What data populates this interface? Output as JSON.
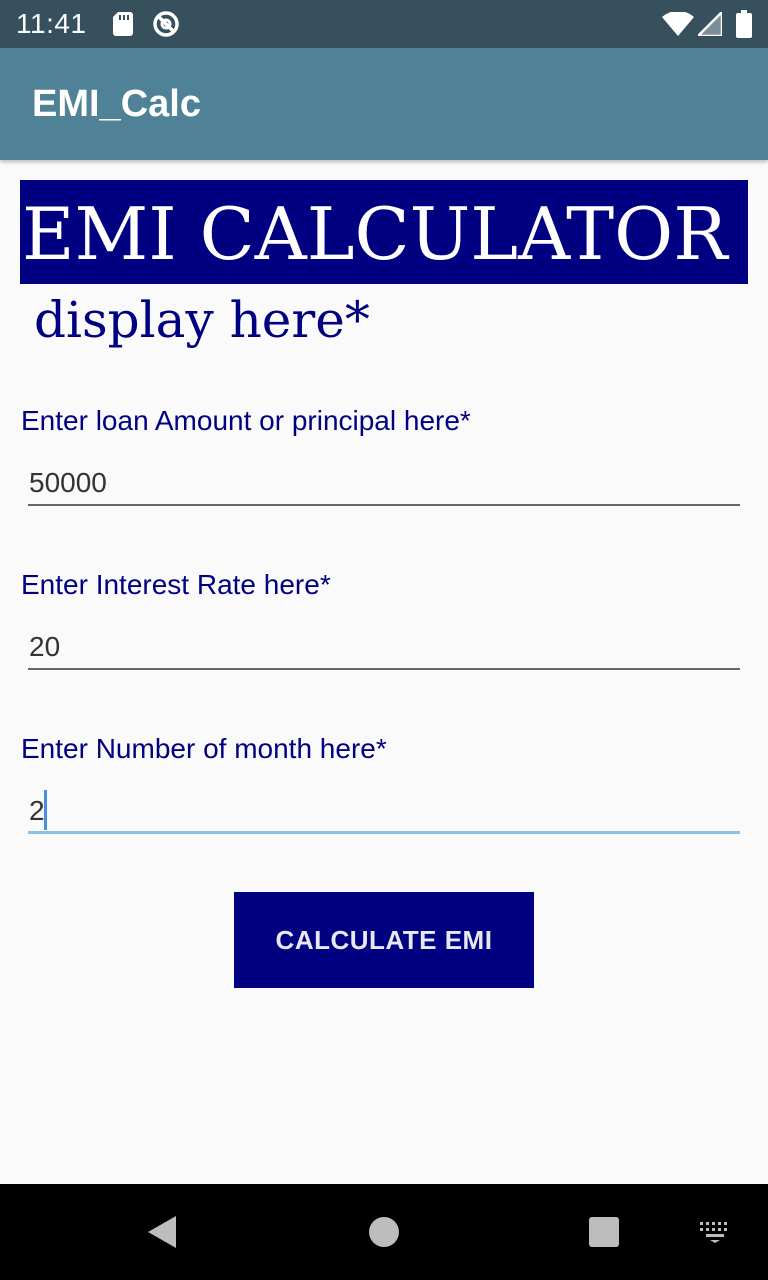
{
  "status_bar": {
    "time": "11:41",
    "icons": [
      "sd-card-icon",
      "sync-disabled-icon",
      "wifi-icon",
      "signal-icon",
      "battery-icon"
    ]
  },
  "app_bar": {
    "title": "EMI_Calc",
    "color": "#4f8297"
  },
  "main": {
    "banner_title": "EMI CALCULATOR",
    "result_display": "display here*",
    "fields": [
      {
        "label": "Enter loan Amount or principal here*",
        "value": "50000"
      },
      {
        "label": "Enter Interest Rate here*",
        "value": "20"
      },
      {
        "label": "Enter Number of month here*",
        "value": "2"
      }
    ],
    "calculate_button": "CALCULATE EMI",
    "accent_color": "#000080"
  },
  "nav_bar": {
    "icons": [
      "back-icon",
      "home-icon",
      "recents-icon",
      "keyboard-icon"
    ]
  }
}
